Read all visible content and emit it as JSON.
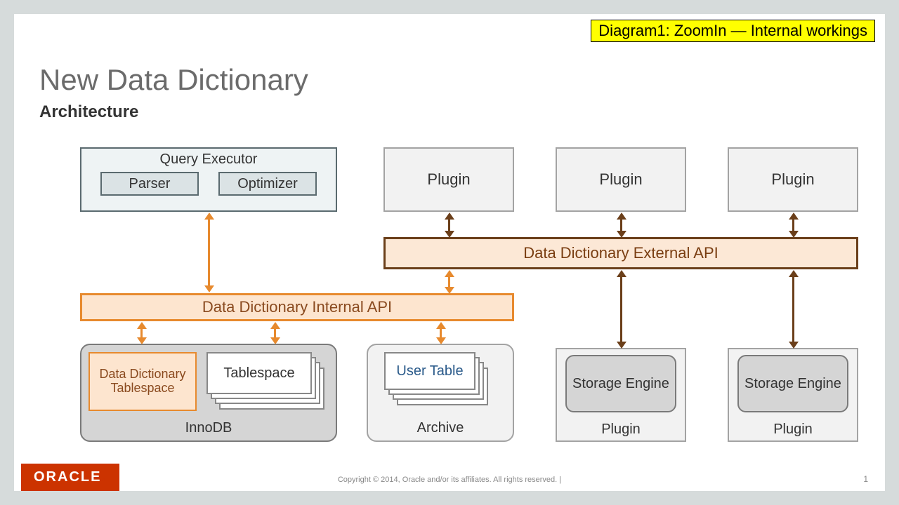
{
  "badge": "Diagram1:  ZoomIn — Internal workings",
  "title": "New Data Dictionary",
  "subtitle": "Architecture",
  "query_executor": {
    "label": "Query Executor",
    "parser": "Parser",
    "optimizer": "Optimizer"
  },
  "top_plugins": [
    "Plugin",
    "Plugin",
    "Plugin"
  ],
  "external_api": "Data Dictionary External API",
  "internal_api": "Data Dictionary Internal API",
  "innodb": {
    "dd_tablespace": "Data Dictionary Tablespace",
    "tablespace": "Tablespace",
    "label": "InnoDB"
  },
  "archive": {
    "user_table": "User Table",
    "label": "Archive"
  },
  "storage_engine": "Storage Engine",
  "bottom_plugin_label": "Plugin",
  "footer": {
    "brand": "ORACLE",
    "copyright": "Copyright © 2014, Oracle and/or its affiliates. All rights reserved.  |",
    "page": "1"
  },
  "arrows": [
    {
      "color": "orange",
      "comment": "QueryExecutor <-> InternalAPI"
    },
    {
      "color": "orange",
      "comment": "InternalAPI <-> InnoDB(DD Tablespace)"
    },
    {
      "color": "orange",
      "comment": "InternalAPI <-> InnoDB(Tablespace)"
    },
    {
      "color": "orange",
      "comment": "InternalAPI <-> Archive"
    },
    {
      "color": "orange",
      "comment": "ExternalAPI <-> InternalAPI"
    },
    {
      "color": "brown",
      "comment": "Plugin1 <-> ExternalAPI"
    },
    {
      "color": "brown",
      "comment": "Plugin2 <-> ExternalAPI"
    },
    {
      "color": "brown",
      "comment": "Plugin3 <-> ExternalAPI"
    },
    {
      "color": "brown",
      "comment": "ExternalAPI <-> StorageEngine1"
    },
    {
      "color": "brown",
      "comment": "ExternalAPI <-> StorageEngine2"
    }
  ]
}
